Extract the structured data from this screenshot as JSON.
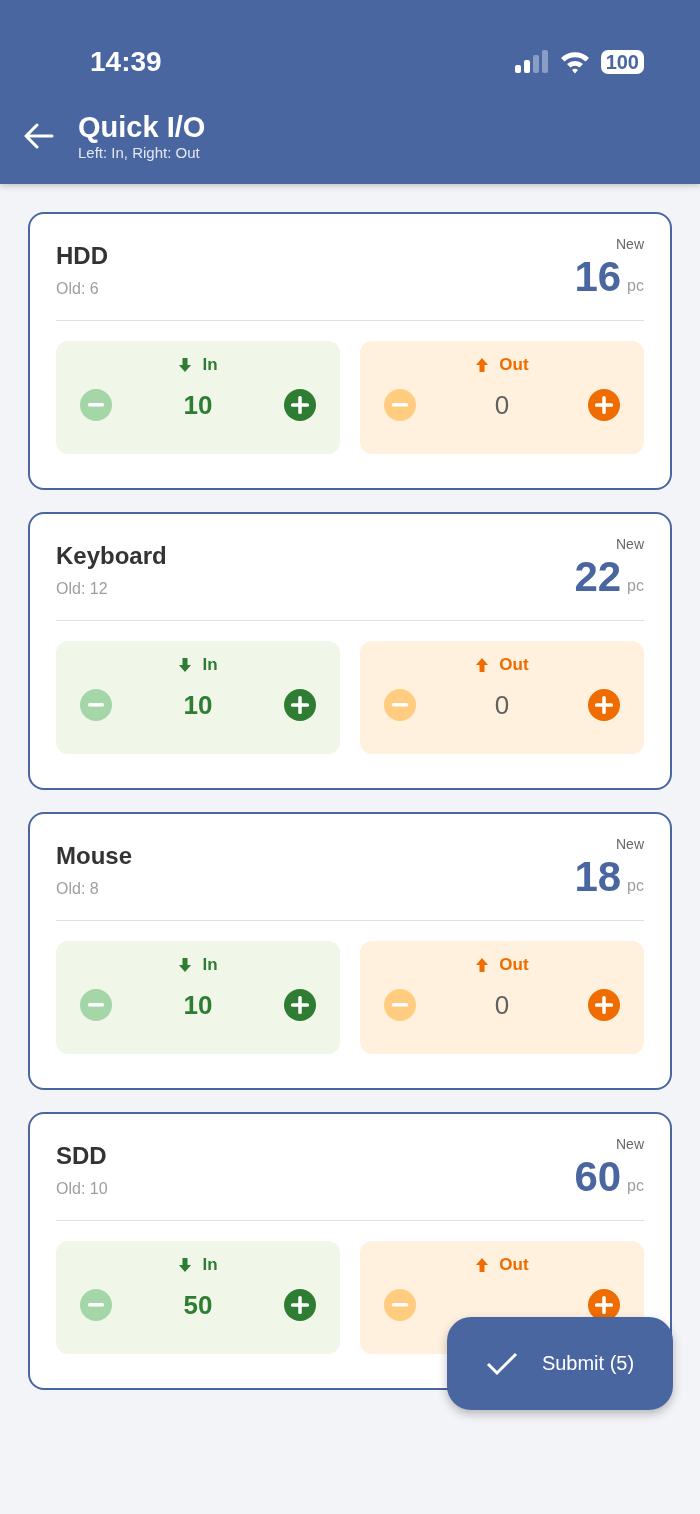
{
  "status_bar": {
    "time": "14:39",
    "battery": "100"
  },
  "app_bar": {
    "title": "Quick I/O",
    "subtitle": "Left: In, Right: Out"
  },
  "items": [
    {
      "name": "HDD",
      "old": "Old: 6",
      "new_label": "New",
      "new_value": "16",
      "unit": "pc",
      "panels": [
        {
          "kind": "in",
          "label": "In",
          "value": "10"
        },
        {
          "kind": "out",
          "label": "Out",
          "value": "0"
        }
      ]
    },
    {
      "name": "Keyboard",
      "old": "Old: 12",
      "new_label": "New",
      "new_value": "22",
      "unit": "pc",
      "panels": [
        {
          "kind": "in",
          "label": "In",
          "value": "10"
        },
        {
          "kind": "out",
          "label": "Out",
          "value": "0"
        }
      ]
    },
    {
      "name": "Mouse",
      "old": "Old: 8",
      "new_label": "New",
      "new_value": "18",
      "unit": "pc",
      "panels": [
        {
          "kind": "in",
          "label": "In",
          "value": "10"
        },
        {
          "kind": "out",
          "label": "Out",
          "value": "0"
        }
      ]
    },
    {
      "name": "SDD",
      "old": "Old: 10",
      "new_label": "New",
      "new_value": "60",
      "unit": "pc",
      "panels": [
        {
          "kind": "in",
          "label": "In",
          "value": "50"
        },
        {
          "kind": "out",
          "label": "Out"
        }
      ]
    }
  ],
  "submit": {
    "label": "Submit (5)"
  }
}
